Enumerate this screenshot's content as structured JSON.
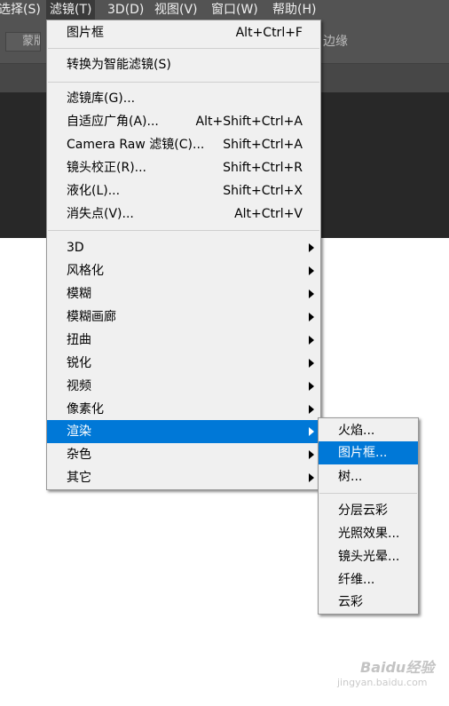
{
  "menubar": {
    "items": [
      "选择(S)",
      "滤镜(T)",
      "3D(D)",
      "视图(V)",
      "窗口(W)",
      "帮助(H)"
    ]
  },
  "options_bar": {
    "left_widget_text": "蒙版",
    "right_text": "边缘"
  },
  "filter_menu": {
    "top_item": {
      "label": "图片框",
      "shortcut": "Alt+Ctrl+F"
    },
    "convert_item": {
      "label": "转换为智能滤镜(S)"
    },
    "tool_items": [
      {
        "label": "滤镜库(G)...",
        "shortcut": ""
      },
      {
        "label": "自适应广角(A)...",
        "shortcut": "Alt+Shift+Ctrl+A"
      },
      {
        "label": "Camera Raw 滤镜(C)...",
        "shortcut": "Shift+Ctrl+A"
      },
      {
        "label": "镜头校正(R)...",
        "shortcut": "Shift+Ctrl+R"
      },
      {
        "label": "液化(L)...",
        "shortcut": "Shift+Ctrl+X"
      },
      {
        "label": "消失点(V)...",
        "shortcut": "Alt+Ctrl+V"
      }
    ],
    "category_items": [
      {
        "label": "3D"
      },
      {
        "label": "风格化"
      },
      {
        "label": "模糊"
      },
      {
        "label": "模糊画廊"
      },
      {
        "label": "扭曲"
      },
      {
        "label": "锐化"
      },
      {
        "label": "视频"
      },
      {
        "label": "像素化"
      },
      {
        "label": "渲染"
      },
      {
        "label": "杂色"
      },
      {
        "label": "其它"
      }
    ],
    "highlighted_category": "渲染"
  },
  "render_submenu": {
    "group1": [
      "火焰...",
      "图片框...",
      "树..."
    ],
    "group2": [
      "分层云彩",
      "光照效果...",
      "镜头光晕...",
      "纤维...",
      "云彩"
    ],
    "highlighted_item": "图片框..."
  },
  "watermark": {
    "logo": "Baidu经验",
    "sub": "jingyan.baidu.com"
  },
  "colors": {
    "menu_bg": "#f0f0f0",
    "highlight": "#0078d7",
    "menubar_bg": "#535353",
    "canvas_dark": "#282828"
  }
}
